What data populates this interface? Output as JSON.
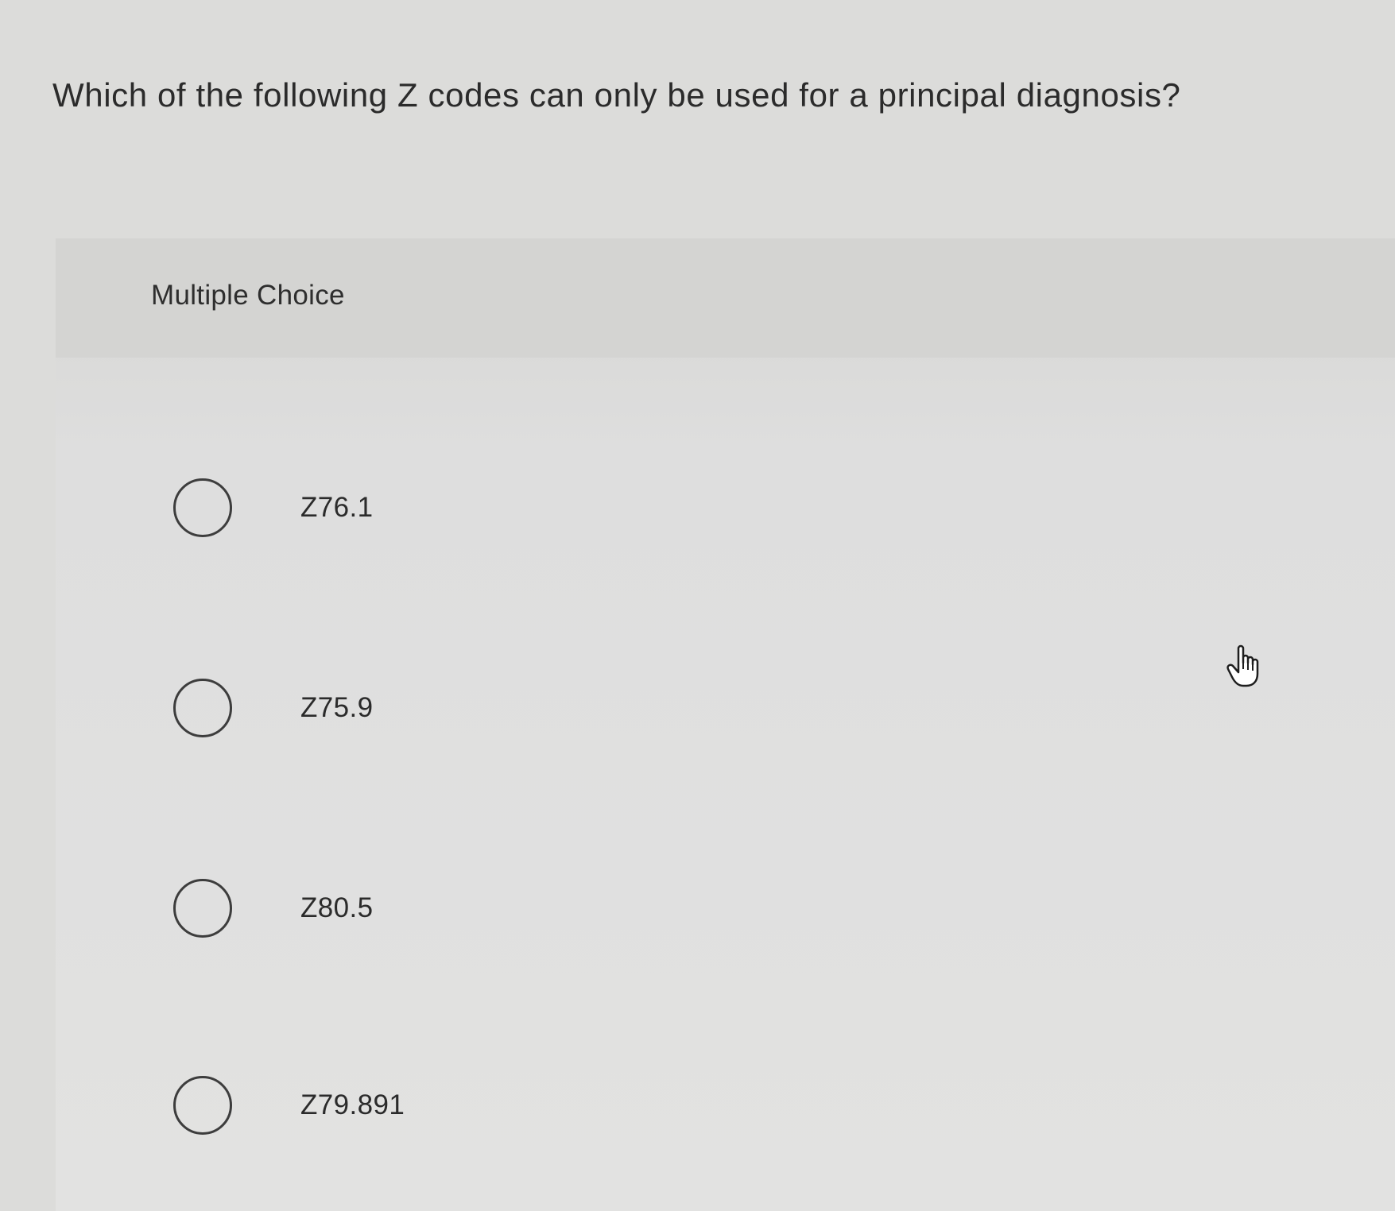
{
  "question": {
    "text": "Which of the following Z codes can only be used for a principal diagnosis?"
  },
  "panel": {
    "type_label": "Multiple Choice",
    "options": [
      {
        "label": "Z76.1",
        "selected": false
      },
      {
        "label": "Z75.9",
        "selected": false
      },
      {
        "label": "Z80.5",
        "selected": false
      },
      {
        "label": "Z79.891",
        "selected": false
      }
    ]
  },
  "cursor": {
    "icon": "hand-pointer-icon"
  }
}
